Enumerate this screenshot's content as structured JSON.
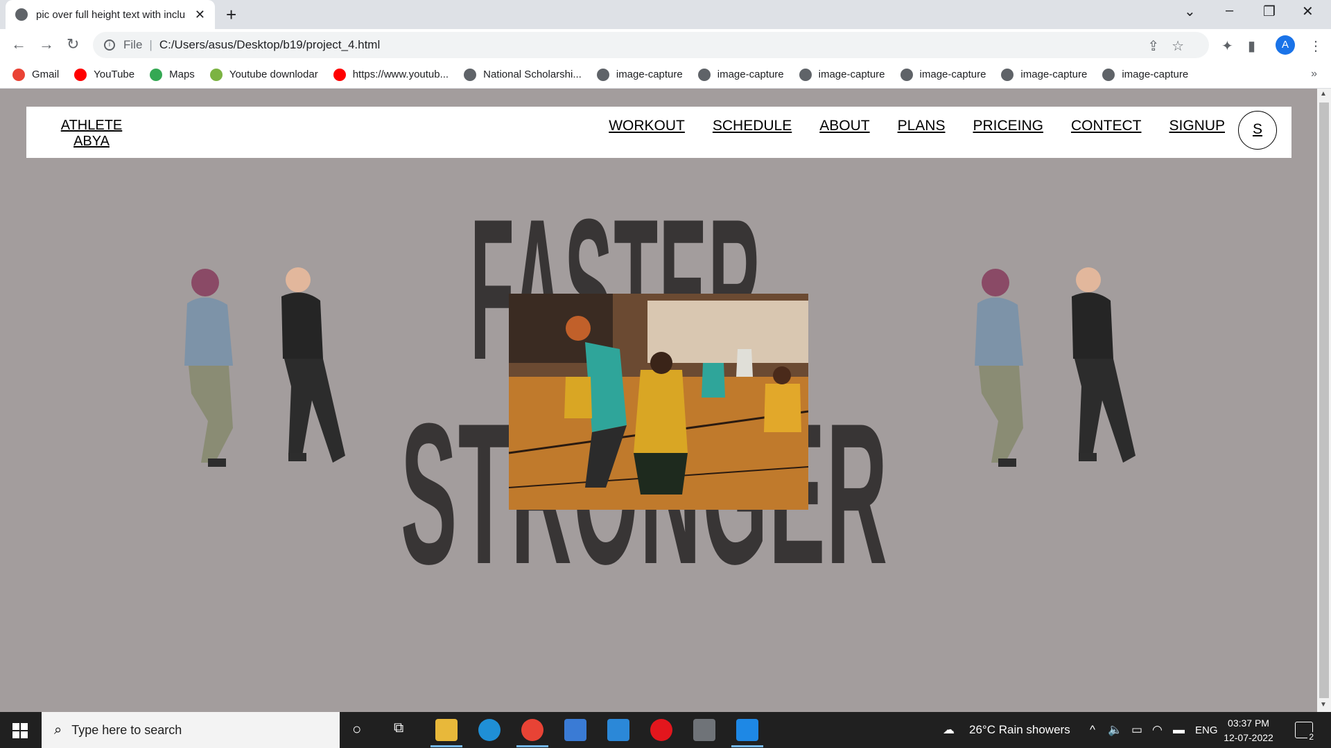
{
  "browser": {
    "tab_title": "pic over full height text with inclu",
    "url_scheme": "File",
    "url": "C:/Users/asus/Desktop/b19/project_4.html",
    "profile_initial": "A",
    "bookmarks": [
      {
        "label": "Gmail",
        "icon": "gmail-icon",
        "color": "#ea4335"
      },
      {
        "label": "YouTube",
        "icon": "youtube-icon",
        "color": "#ff0000"
      },
      {
        "label": "Maps",
        "icon": "maps-icon",
        "color": "#34a853"
      },
      {
        "label": "Youtube downlodar",
        "icon": "download-icon",
        "color": "#7cb342"
      },
      {
        "label": "https://www.youtub...",
        "icon": "youtube-icon",
        "color": "#ff0000"
      },
      {
        "label": "National Scholarshi...",
        "icon": "globe-icon",
        "color": "#5f6368"
      },
      {
        "label": "image-capture",
        "icon": "globe-icon",
        "color": "#5f6368"
      },
      {
        "label": "image-capture",
        "icon": "globe-icon",
        "color": "#5f6368"
      },
      {
        "label": "image-capture",
        "icon": "globe-icon",
        "color": "#5f6368"
      },
      {
        "label": "image-capture",
        "icon": "globe-icon",
        "color": "#5f6368"
      },
      {
        "label": "image-capture",
        "icon": "globe-icon",
        "color": "#5f6368"
      },
      {
        "label": "image-capture",
        "icon": "globe-icon",
        "color": "#5f6368"
      }
    ],
    "more_bookmarks": "»"
  },
  "site": {
    "logo_line1": "ATHLETE",
    "logo_line2": "ABYA",
    "menu": [
      "WORKOUT",
      "SCHEDULE",
      "ABOUT",
      "PLANS",
      "PRICEING",
      "CONTECT",
      "SIGNUP"
    ],
    "avatar_letter": "S",
    "hero_line1": "FASTER",
    "hero_line2": "STRONGER",
    "background_color": "#a39d9d",
    "text_color": "#383535"
  },
  "taskbar": {
    "search_placeholder": "Type here to search",
    "weather": "26°C  Rain showers",
    "language": "ENG",
    "time": "03:37 PM",
    "date": "12-07-2022",
    "notification_count": "2"
  }
}
